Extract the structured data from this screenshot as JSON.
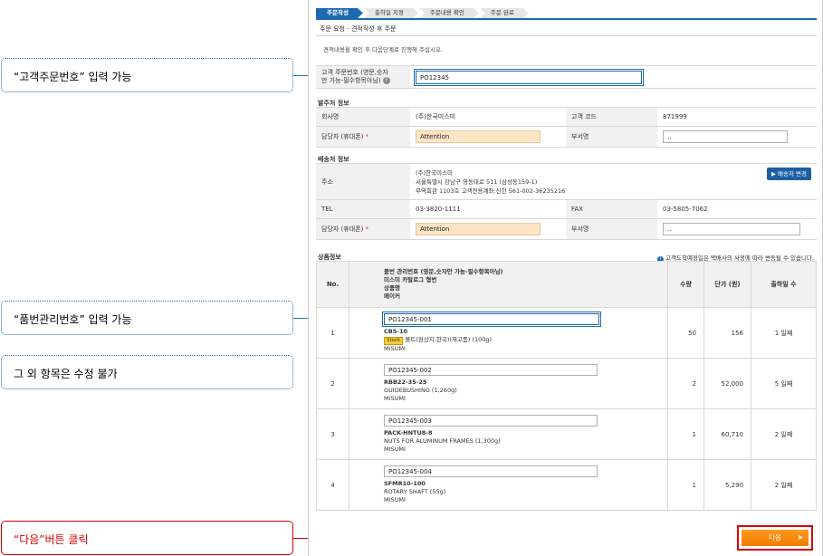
{
  "callouts": {
    "customer_order_no": "“고객주문번호” 입력 가능",
    "part_mgmt_no": "“품번관리번호” 입력 가능",
    "other_items": "그 외 항목은 수정 불가",
    "next_click": "“다음”버튼 클릭"
  },
  "steps": [
    "주문작성",
    "출하일 지정",
    "주문내용 확인",
    "주문 완료"
  ],
  "page_subtitle": "주문 요청 - 견적작성 후 주문",
  "guide_text": "견적내용을 확인 후 다음단계로 진행해 주십시오.",
  "customer_order": {
    "label_line1": "고객 주문번호 (영문,숫자",
    "label_line2": "만 가능-필수항목아님)",
    "help_icon": "?",
    "value": "PO12345"
  },
  "orderer": {
    "section_title": "발주처 정보",
    "company_label": "회사명",
    "company_value": "(주)한국미스미",
    "customer_code_label": "고객 코드",
    "customer_code_value": "871999",
    "person_label": "담당자 (휴대폰)",
    "required_mark": "*",
    "person_value": "Attention",
    "dept_label": "부서명",
    "dept_value": ".."
  },
  "shipping": {
    "section_title": "배송처 정보",
    "address_label": "주소",
    "address_lines": [
      "(주)한국미스미",
      "서울특별시 강남구 영동대로 511 (삼성동159-1)",
      "무역회관 1103호 고객전용계좌:신한 561-002-36235216"
    ],
    "change_button": "배송처 변경",
    "tel_label": "TEL",
    "tel_value": "03-3820-1111",
    "fax_label": "FAX",
    "fax_value": "03-5805-7062",
    "person_label": "담당자 (휴대폰)",
    "required_mark": "*",
    "person_value": "Attention",
    "dept_label": "부서명",
    "dept_value": ".."
  },
  "products": {
    "section_title": "상품정보",
    "note": "고객도착예정일은 택배사의 사정에 따라 변동될 수 있습니다.",
    "note_icon": "i",
    "headers": {
      "no": "No.",
      "info_lines": [
        "품번 관리번호 (영문,숫자만 가능-필수항목아님)",
        "미스미 카탈로그 형번",
        "상품명",
        "메이커"
      ],
      "qty": "수량",
      "price": "단가 (원)",
      "ship_days": "출하일 수"
    },
    "rows": [
      {
        "no": "1",
        "mgmt_no": "PO12345-001",
        "catalog_no": "CB5-10",
        "stock_tag": "Stock",
        "name": "볼트(원산지:한국)(재고품) (100g)",
        "maker": "MISUMI",
        "qty": "50",
        "price": "156",
        "days": "1 일째"
      },
      {
        "no": "2",
        "mgmt_no": "PO12345-002",
        "catalog_no": "RBB22-35-25",
        "stock_tag": "",
        "name": "GUIDEBUSHING (1,260g)",
        "maker": "MISUMI",
        "qty": "2",
        "price": "52,000",
        "days": "5 일째"
      },
      {
        "no": "3",
        "mgmt_no": "PO12345-003",
        "catalog_no": "PACK-HNTU8-8",
        "stock_tag": "",
        "name": "NUTS FOR ALUMINUM FRAMES (1,300g)",
        "maker": "MISUMI",
        "qty": "1",
        "price": "60,710",
        "days": "2 일째"
      },
      {
        "no": "4",
        "mgmt_no": "PO12345-004",
        "catalog_no": "SFMR10-100",
        "stock_tag": "",
        "name": "ROTARY SHAFT (55g)",
        "maker": "MISUMI",
        "qty": "1",
        "price": "5,290",
        "days": "2 일째"
      }
    ]
  },
  "next_button": "다음",
  "next_arrow": "▶",
  "colors": {
    "accent": "#1c6bb0",
    "orange": "#f07c00",
    "callout_red": "#d80000"
  }
}
